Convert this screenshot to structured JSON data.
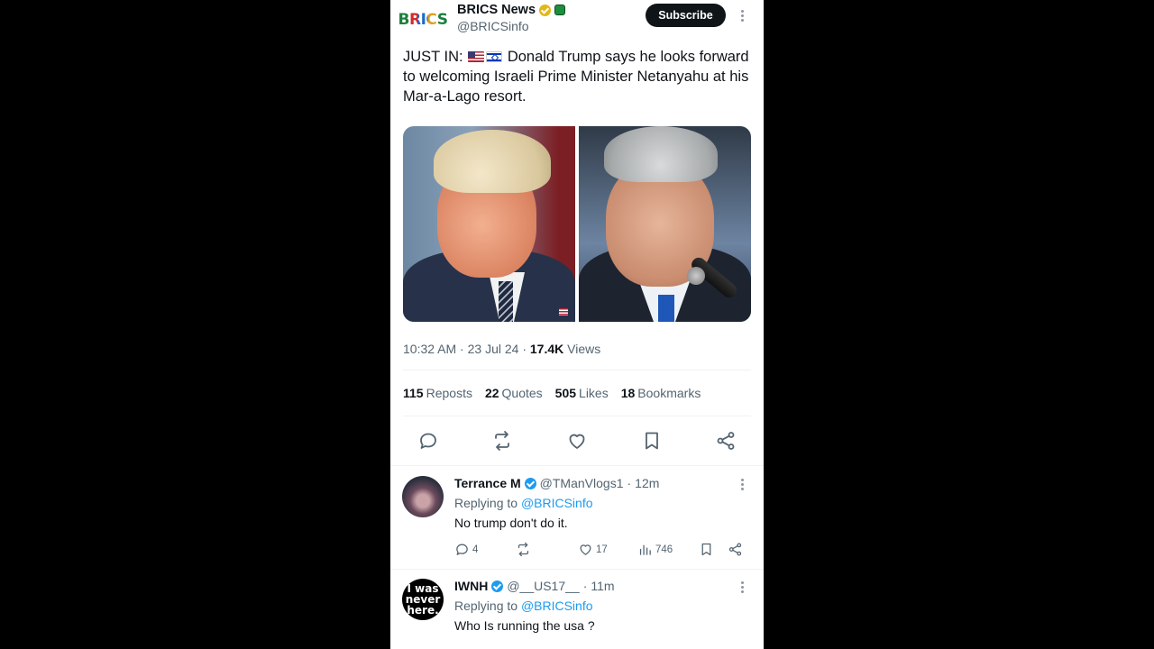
{
  "post": {
    "logo_text": "BRICS",
    "account_name": "BRICS News",
    "handle": "@BRICSinfo",
    "subscribe_label": "Subscribe",
    "text_prefix": "JUST IN:",
    "text_body": "Donald Trump says he looks forward to welcoming Israeli Prime Minister Netanyahu at his Mar-a-Lago resort.",
    "time": "10:32 AM",
    "date": "23 Jul 24",
    "views_count": "17.4K",
    "views_label": "Views",
    "stats": {
      "reposts_count": "115",
      "reposts_label": "Reposts",
      "quotes_count": "22",
      "quotes_label": "Quotes",
      "likes_count": "505",
      "likes_label": "Likes",
      "bookmarks_count": "18",
      "bookmarks_label": "Bookmarks"
    },
    "icons": [
      "reply-icon",
      "repost-icon",
      "like-icon",
      "bookmark-icon",
      "share-icon"
    ]
  },
  "replies": [
    {
      "name": "Terrance M",
      "handle": "@TManVlogs1",
      "time": "12m",
      "replying_prefix": "Replying to",
      "replying_to": "@BRICSinfo",
      "text": "No trump don't do it.",
      "reply_count": "4",
      "like_count": "17",
      "view_count": "746"
    },
    {
      "name": "IWNH",
      "handle": "@__US17__",
      "time": "11m",
      "avatar_text_1": "I was",
      "avatar_text_2": "never",
      "avatar_text_3": "here.",
      "replying_prefix": "Replying to",
      "replying_to": "@BRICSinfo",
      "text": "Who Is running the usa ?"
    }
  ],
  "colors": {
    "text_primary": "#0f1419",
    "text_secondary": "#536471",
    "link": "#1d9bf0",
    "verified_gold": "#e2b719",
    "verified_blue": "#1d9bf0",
    "background_outer": "#000000"
  }
}
